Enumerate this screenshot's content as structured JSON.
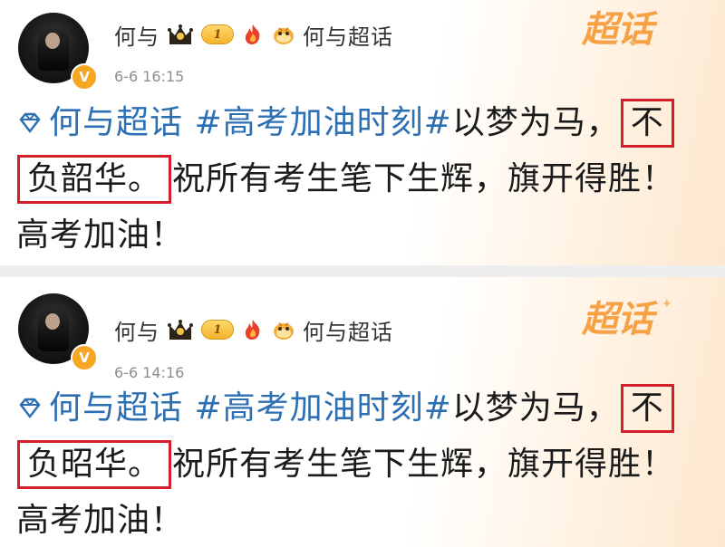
{
  "posts": [
    {
      "username": "何与",
      "level": "1",
      "supertag": "何与超话",
      "time": "6-6 16:15",
      "brand": "超话",
      "content": {
        "line1_tag": "何与超话 #高考加油时刻#",
        "line1_text": "以梦为马，",
        "line1_hi": "不",
        "line2_hi": "负韶华。",
        "line2_text": "祝所有考生笔下生辉，旗开得胜！",
        "line3_text": "高考加油！"
      }
    },
    {
      "username": "何与",
      "level": "1",
      "supertag": "何与超话",
      "time": "6-6 14:16",
      "brand": "超话",
      "content": {
        "line1_tag": "何与超话 #高考加油时刻#",
        "line1_text": "以梦为马，",
        "line1_hi": "不",
        "line2_hi": "负昭华。",
        "line2_text": "祝所有考生笔下生辉，旗开得胜！",
        "line3_text": "高考加油！"
      }
    }
  ],
  "colors": {
    "tag": "#2d6fb3",
    "highlight_box": "#d21f2b",
    "brand": "#f7a145",
    "badge": "#f5a623"
  },
  "icons": {
    "verified": "verified-badge-icon",
    "crown": "crown-icon",
    "fire": "fire-emoji-icon",
    "face": "face-emoji-icon",
    "diamond": "diamond-icon"
  }
}
